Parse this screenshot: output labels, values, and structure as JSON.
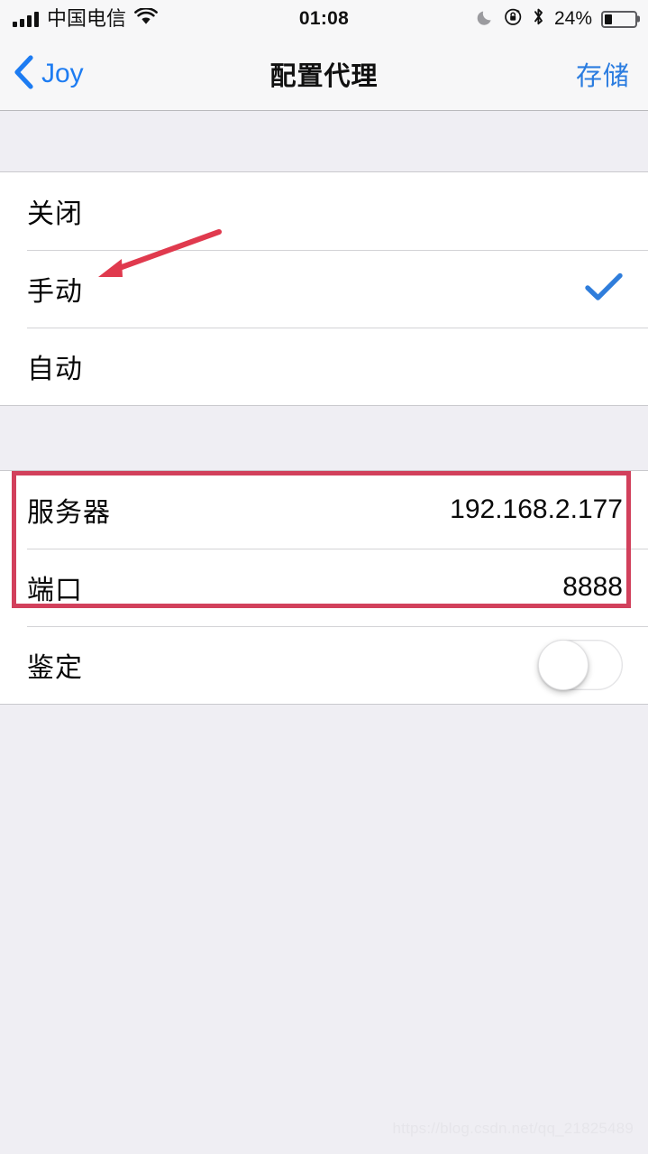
{
  "status_bar": {
    "carrier": "中国电信",
    "signal_icon": "signal-bars-icon",
    "wifi_icon": "wifi-icon",
    "time": "01:08",
    "dnd_icon": "moon-icon",
    "rotation_lock_icon": "rotation-lock-icon",
    "bluetooth_icon": "bluetooth-icon",
    "battery_percent": "24%",
    "battery_level": 24
  },
  "nav_bar": {
    "back_label": "Joy",
    "back_icon": "chevron-left-icon",
    "title": "配置代理",
    "action_label": "存储"
  },
  "groups": [
    {
      "rows": [
        {
          "label": "关闭",
          "value": "",
          "accessory": "none"
        },
        {
          "label": "手动",
          "value": "",
          "accessory": "checkmark"
        },
        {
          "label": "自动",
          "value": "",
          "accessory": "none"
        }
      ]
    },
    {
      "rows": [
        {
          "label": "服务器",
          "value": "192.168.2.177",
          "accessory": "none"
        },
        {
          "label": "端口",
          "value": "8888",
          "accessory": "none"
        },
        {
          "label": "鉴定",
          "value": "",
          "accessory": "toggle",
          "toggle_on": false
        }
      ]
    }
  ],
  "annotations": {
    "arrow": {
      "name": "red-arrow-annotation",
      "color": "#e03a4e",
      "points_to": "手动"
    },
    "rectangle": {
      "name": "red-rectangle-annotation",
      "color": "#d2405c",
      "surrounds": "服务器 / 端口"
    }
  },
  "watermark": "https://blog.csdn.net/qq_21825489",
  "colors": {
    "accent_blue": "#2a7ce0",
    "checkmark_blue": "#2f7ddb",
    "annotation_red": "#d2405c",
    "background_gray": "#efeef3",
    "row_white": "#ffffff",
    "separator": "#d3d3d6"
  }
}
